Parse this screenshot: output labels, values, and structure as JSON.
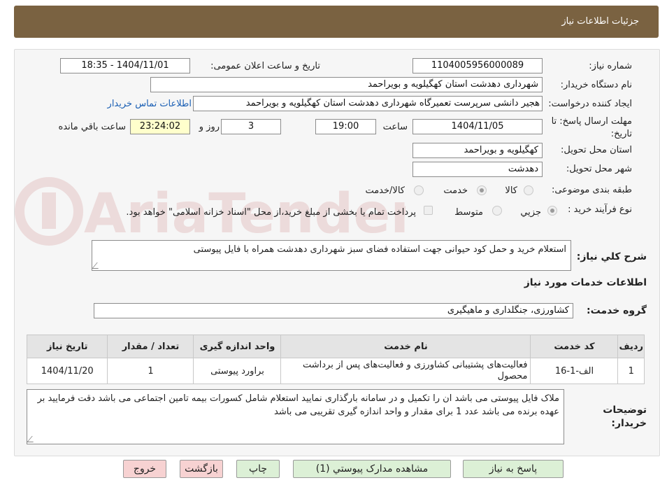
{
  "header": {
    "title": "جزئیات اطلاعات نیاز"
  },
  "fields": {
    "need_number_label": "شماره نیاز:",
    "need_number": "1104005956000089",
    "announce_label": "تاریخ و ساعت اعلان عمومی:",
    "announce_value": "1404/11/01 - 18:35",
    "buyer_org_label": "نام دستگاه خریدار:",
    "buyer_org": "شهرداری دهدشت استان کهگیلویه و بویراحمد",
    "creator_label": "ایجاد کننده درخواست:",
    "creator": "هجیر دانشی سرپرست تعمیرگاه شهرداری دهدشت استان کهگیلویه و بویراحمد",
    "contact_link": "اطلاعات تماس خریدار",
    "deadline_label_1": "مهلت ارسال پاسخ: تا",
    "deadline_label_2": "تاریخ:",
    "deadline_date": "1404/11/05",
    "time_label": "ساعت",
    "deadline_time": "19:00",
    "days_value": "3",
    "days_label": "روز و",
    "remaining_time": "23:24:02",
    "remaining_label": "ساعت باقي مانده",
    "province_label": "استان محل تحویل:",
    "province": "کهگیلویه و بویراحمد",
    "city_label": "شهر محل تحویل:",
    "city": "دهدشت",
    "category_label": "طبقه بندی موضوعی:",
    "category_options": [
      "کالا",
      "خدمت",
      "کالا/خدمت"
    ],
    "category_selected": "خدمت",
    "process_label": "نوع فرآیند خرید :",
    "process_options": [
      "جزیي",
      "متوسط"
    ],
    "process_selected": "جزیي",
    "payment_note": "پرداخت تمام یا بخشی از مبلغ خرید،از محل \"اسناد خزانه اسلامی\" خواهد بود."
  },
  "summary": {
    "label": "شرح کلي نیاز:",
    "text": "استعلام خرید و حمل کود حیوانی جهت استفاده فضای سبز شهرداری دهدشت همراه با فایل پیوستی"
  },
  "services_section": {
    "title": "اطلاعات خدمات مورد نیاز",
    "group_label": "گروه خدمت:",
    "group_value": "کشاورزی، جنگلداری و ماهیگیری"
  },
  "table": {
    "headers": [
      "ردیف",
      "کد خدمت",
      "نام خدمت",
      "واحد اندازه گیری",
      "تعداد / مقدار",
      "تاریخ نیاز"
    ],
    "rows": [
      [
        "1",
        "الف-1-16",
        "فعالیت‌های پشتیبانی کشاورزی و فعالیت‌های پس از برداشت محصول",
        "براورد پیوستی",
        "1",
        "1404/11/20"
      ]
    ]
  },
  "buyer_notes": {
    "label_1": "توضیحات",
    "label_2": "خریدار:",
    "text": "ملاک فایل پیوستی می باشد ان را تکمیل و در سامانه بارگذاری نمایید استعلام شامل کسورات بیمه تامین اجتماعی می باشد دقت فرمایید بر عهده برنده می باشد عدد 1 برای مقدار و واحد اندازه گیری تقریبی می باشد"
  },
  "buttons": {
    "reply": "پاسخ به نیاز",
    "view_docs": "مشاهده مدارک پیوستي (1)",
    "print": "چاپ",
    "back": "بازگشت",
    "exit": "خروج"
  },
  "watermark": {
    "text": "AriaTender.neT"
  },
  "colors": {
    "header_bg": "#7a6241",
    "link": "#1a5fb4",
    "remaining_bg": "#ffffcc",
    "button_green": "#dcf0d6",
    "button_pink": "#f7d2d2"
  }
}
